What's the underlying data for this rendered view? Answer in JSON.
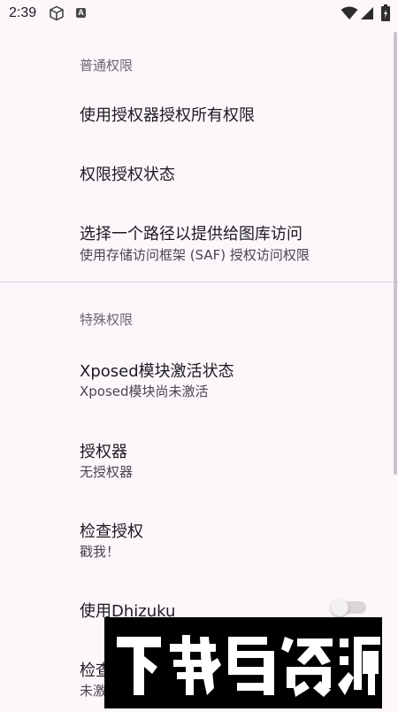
{
  "status_bar": {
    "time": "2:39",
    "icons": [
      "cube-icon",
      "a-badge-icon",
      "wifi-icon",
      "signal-icon",
      "battery-icon"
    ],
    "a_badge_text": "A"
  },
  "sections": {
    "normal": {
      "title": "普通权限",
      "items": [
        {
          "title": "使用授权器授权所有权限"
        },
        {
          "title": "权限授权状态"
        },
        {
          "title": "选择一个路径以提供给图库访问",
          "summary": "使用存储访问框架 (SAF) 授权访问权限"
        }
      ]
    },
    "special": {
      "title": "特殊权限",
      "items": [
        {
          "title": "Xposed模块激活状态",
          "summary": "Xposed模块尚未激活"
        },
        {
          "title": "授权器",
          "summary": "无授权器"
        },
        {
          "title": "检查授权",
          "summary": "戳我！"
        },
        {
          "title": "使用Dhizuku",
          "toggle_on": false
        },
        {
          "title": "检查",
          "summary": "未激"
        }
      ]
    }
  },
  "colors": {
    "background": "#fdf7fc",
    "section_title": "#6b6670",
    "watermark_bg": "#000000"
  }
}
